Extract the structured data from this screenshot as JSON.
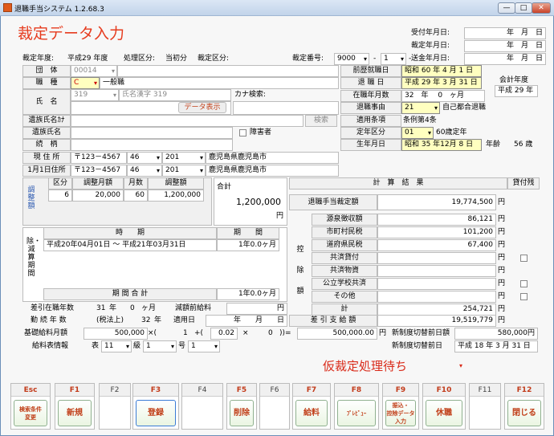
{
  "window": {
    "title": "退職手当システム 1.2.68.3",
    "min": "—",
    "max": "□",
    "close": "✕"
  },
  "header": {
    "title": "裁定データ入力",
    "uketsuke_label": "受付年月日:",
    "saitei_label": "裁定年月日:",
    "soukin_label": "送金年月日:",
    "ym_empty": "年　月　日",
    "year_label": "裁定年度:",
    "year_value": "平成29 年度",
    "shori_label": "処理区分:",
    "shori_value": "当初分",
    "kubun_label": "裁定区分:",
    "bango_label": "裁定番号:",
    "bango1": "9000",
    "dash1": "-",
    "bango2": "1",
    "dash2": "-"
  },
  "left": {
    "dantai_label": "団　体",
    "dantai_code": "00014",
    "shokushu_label": "職　種",
    "shokushu_code": "C",
    "shokushu_name": "一般職",
    "shimei_label": "氏　名",
    "shimei_code": "319",
    "shimei_kanji": "氏名漢字 319",
    "kana_label": "カナ検索:",
    "data_btn": "データ表示",
    "search_btn": "検索",
    "izoku_kana_label": "遺族氏名ｶﾅ",
    "izoku_label": "遺族氏名",
    "shogai_label": "障害者",
    "zokugara_label": "続　柄",
    "genjusho_label": "現 住 所",
    "zip1": "〒123－4567",
    "pref1": "46",
    "city1": "201",
    "addr1": "鹿児島県鹿児島市",
    "jusho0101_label": "1月1日住所",
    "zip2": "〒123－4567",
    "pref2": "46",
    "city2": "201",
    "addr2": "鹿児島県鹿児島市"
  },
  "right": {
    "zenreki_label": "前歴就職日",
    "zenreki_value": "昭和 60 年 4 月 1 日",
    "taishoku_label": "退 職 日",
    "taishoku_value": "平成 29 年 3 月 31 日",
    "kaikei_label": "会計年度",
    "kaikei_value": "平成 29 年",
    "zaishoku_label": "在職年月数",
    "zaishoku_value": "32　年　 0　ヶ月",
    "jiyu_label": "退職事由",
    "jiyu_code": "21",
    "jiyu_name": "自己都合退職",
    "tekiyo_label": "適用条項",
    "tekiyo_value": "条例第4条",
    "teinen_label": "定年区分",
    "teinen_code": "01",
    "teinen_name": "60歳定年",
    "seinen_label": "生年月日",
    "seinen_value": "昭和 35 年12月 8 日",
    "nenrei_label": "年齢",
    "nenrei_value": "56 歳"
  },
  "chosei": {
    "side": "調整額",
    "headers": [
      "区分",
      "調整月額",
      "月数",
      "調整額"
    ],
    "row": [
      "6",
      "20,000",
      "60",
      "1,200,000"
    ],
    "total_label": "合計",
    "total_value": "1,200,000",
    "yen": "円"
  },
  "kikan": {
    "side": "除・減算期間",
    "headers": [
      "時　　期",
      "期　　間"
    ],
    "row": [
      "平成20年04月01日 ～ 平成21年03月31日",
      "1年0.0ヶ月"
    ],
    "sum_label": "期 間 合 計",
    "sum_value": "1年0.0ヶ月"
  },
  "result": {
    "title": "計　算　結　果",
    "kashi_label": "貸付残",
    "taishoku_label": "退職手当裁定額",
    "taishoku_value": "19,774,500",
    "yen": "円",
    "kojo_side": "控除額",
    "items": [
      {
        "label": "源泉徴収額",
        "value": "86,121"
      },
      {
        "label": "市町村民税",
        "value": "101,200"
      },
      {
        "label": "道府県民税",
        "value": "67,400"
      },
      {
        "label": "共済貸付",
        "value": ""
      },
      {
        "label": "共済物資",
        "value": ""
      },
      {
        "label": "公立学校共済",
        "value": ""
      },
      {
        "label": "その他",
        "value": ""
      },
      {
        "label": "計",
        "value": "254,721"
      }
    ],
    "sashihiki_label": "差 引 支 給 額",
    "sashihiki_value": "19,519,779"
  },
  "bottom": {
    "sashihiki_zaishoku_label": "差引在職年数",
    "sz_y": "31",
    "sz_ylbl": "年",
    "sz_m": "0",
    "sz_mlbl": "ヶ月",
    "gengaku_label": "減額前給料",
    "gengaku_yen": "円",
    "kinzoku_label": "勤 続 年 数",
    "kinzoku_sub": "(税法上)",
    "kinzoku_value": "32",
    "kinzoku_unit": "年",
    "tekiyobi_label": "適用日",
    "tekiyobi_value": "年　　月　　日",
    "kiso_label": "基礎給料月額",
    "kiso_value": "500,000",
    "kiso_op1": "×(",
    "kiso_1": "1",
    "kiso_op2": "+(",
    "kiso_rate": "0.02",
    "kiso_op3": "×",
    "kiso_0": "0",
    "kiso_op4": "))=",
    "kiso_result": "500,000.00",
    "kiso_yen": "円",
    "kyuyo_label": "給料表情報",
    "hyo_label": "表",
    "hyo_value": "11",
    "kyu_label": "級",
    "kyu_value": "1",
    "go_label": "号",
    "go_value": "1",
    "shinseido1_label": "新制度切替前日額",
    "shinseido1_value": "580,000円",
    "shinseido2_label": "新制度切替前日",
    "shinseido2_value": "平成 18 年 3 月 31 日",
    "status": "仮裁定処理待ち"
  },
  "fkeys": [
    {
      "key": "Esc",
      "label": "検索条件\n変更",
      "active": true
    },
    {
      "key": "F1",
      "label": "新規",
      "active": true
    },
    {
      "key": "F2",
      "label": "",
      "active": false
    },
    {
      "key": "F3",
      "label": "登録",
      "active": true
    },
    {
      "key": "F4",
      "label": "",
      "active": false
    },
    {
      "key": "F5",
      "label": "削除",
      "active": true
    },
    {
      "key": "F6",
      "label": "",
      "active": false
    },
    {
      "key": "F7",
      "label": "給料",
      "active": true
    },
    {
      "key": "F8",
      "label": "ﾌﾟﾚﾋﾞｭｰ",
      "active": true
    },
    {
      "key": "F9",
      "label": "振込・\n控除データ\n入力",
      "active": true
    },
    {
      "key": "F10",
      "label": "休職",
      "active": true
    },
    {
      "key": "F11",
      "label": "",
      "active": false
    },
    {
      "key": "F12",
      "label": "閉じる",
      "active": true
    }
  ]
}
